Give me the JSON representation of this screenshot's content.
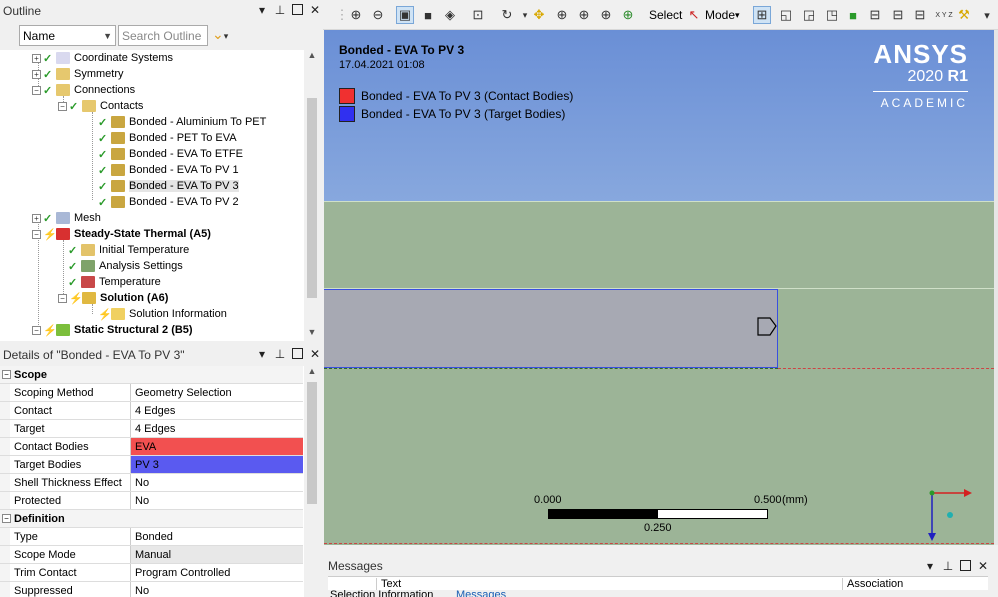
{
  "outline": {
    "title": "Outline",
    "filter_value": "Name",
    "search_placeholder": "Search Outline",
    "tree": [
      {
        "label": "Coordinate Systems"
      },
      {
        "label": "Symmetry"
      },
      {
        "label": "Connections"
      },
      {
        "label": "Contacts"
      },
      {
        "label": "Bonded - Aluminium To PET"
      },
      {
        "label": "Bonded - PET To EVA"
      },
      {
        "label": "Bonded - EVA To ETFE"
      },
      {
        "label": "Bonded - EVA To PV 1"
      },
      {
        "label": "Bonded - EVA To PV 3"
      },
      {
        "label": "Bonded - EVA To PV 2"
      },
      {
        "label": "Mesh"
      },
      {
        "label": "Steady-State Thermal (A5)"
      },
      {
        "label": "Initial Temperature"
      },
      {
        "label": "Analysis Settings"
      },
      {
        "label": "Temperature"
      },
      {
        "label": "Solution (A6)"
      },
      {
        "label": "Solution Information"
      },
      {
        "label": "Static Structural 2 (B5)"
      }
    ]
  },
  "details": {
    "title": "Details of \"Bonded - EVA To PV 3\"",
    "rows": [
      {
        "k": "Scope"
      },
      {
        "k": "Scoping Method",
        "v": "Geometry Selection"
      },
      {
        "k": "Contact",
        "v": "4 Edges"
      },
      {
        "k": "Target",
        "v": "4 Edges"
      },
      {
        "k": "Contact Bodies",
        "v": "EVA"
      },
      {
        "k": "Target Bodies",
        "v": "PV 3"
      },
      {
        "k": "Shell Thickness Effect",
        "v": "No"
      },
      {
        "k": "Protected",
        "v": "No"
      },
      {
        "k": "Definition"
      },
      {
        "k": "Type",
        "v": "Bonded"
      },
      {
        "k": "Scope Mode",
        "v": "Manual"
      },
      {
        "k": "Trim Contact",
        "v": "Program Controlled"
      },
      {
        "k": "Suppressed",
        "v": "No"
      }
    ],
    "contact_color": "#f25050",
    "target_color": "#5a5af0"
  },
  "toolbar": {
    "select_label": "Select",
    "mode_label": "Mode",
    "xyz_label": "X Y Z"
  },
  "viewport": {
    "title": "Bonded - EVA To PV 3",
    "date": "17.04.2021 01:08",
    "legend": [
      {
        "label": "Bonded - EVA To PV 3 (Contact Bodies)",
        "color": "#f03030"
      },
      {
        "label": "Bonded - EVA To PV 3 (Target Bodies)",
        "color": "#3030f0"
      }
    ],
    "brand": "ANSYS",
    "version_year": "2020",
    "version_release": "R1",
    "edition": "ACADEMIC",
    "scale": {
      "left": "0.000",
      "right": "0.500",
      "unit": "(mm)",
      "mid": "0.250"
    }
  },
  "messages": {
    "title": "Messages",
    "col_text": "Text",
    "col_assoc": "Association",
    "tab_selection": "Selection Information",
    "tab_messages": "Messages"
  }
}
